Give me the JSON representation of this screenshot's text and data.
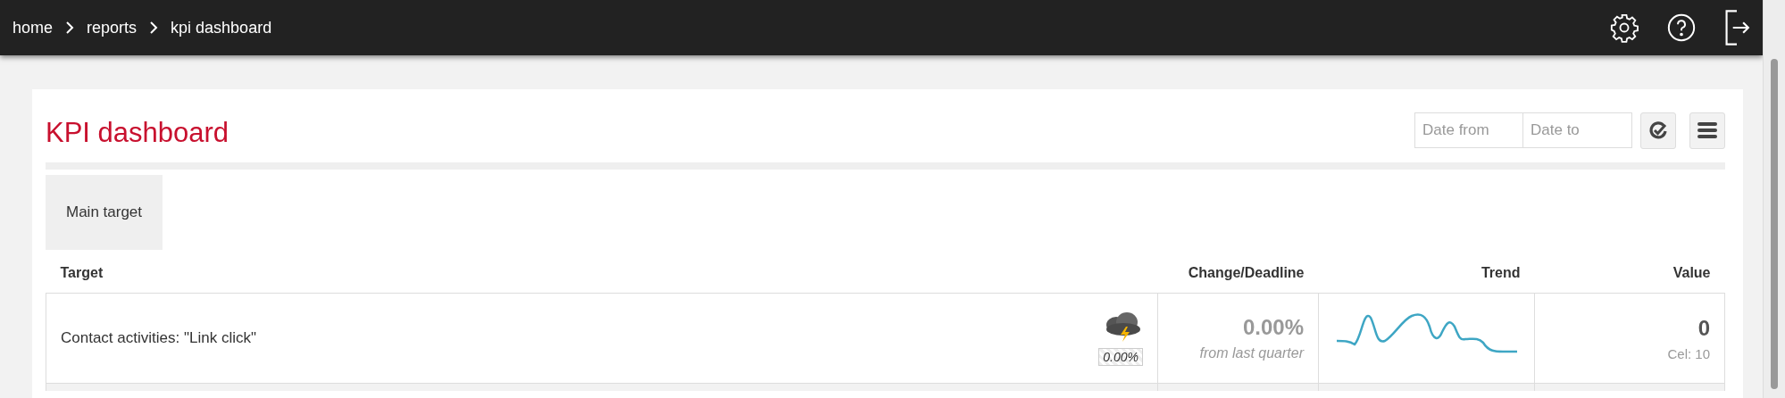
{
  "breadcrumbs": [
    "home",
    "reports",
    "kpi dashboard"
  ],
  "page": {
    "title": "KPI dashboard",
    "date_from": {
      "placeholder": "Date from"
    },
    "date_to": {
      "placeholder": "Date to"
    }
  },
  "tabs": [
    {
      "label": "Main target",
      "selected": true
    }
  ],
  "table": {
    "columns": [
      "Target",
      "Change/Deadline",
      "Trend",
      "Value"
    ],
    "rows": [
      {
        "target": "Contact activities: \"Link click\"",
        "badge": "0.00%",
        "change": "0.00%",
        "change_note": "from last quarter",
        "value": "0",
        "goal": "Cel: 10"
      }
    ]
  }
}
